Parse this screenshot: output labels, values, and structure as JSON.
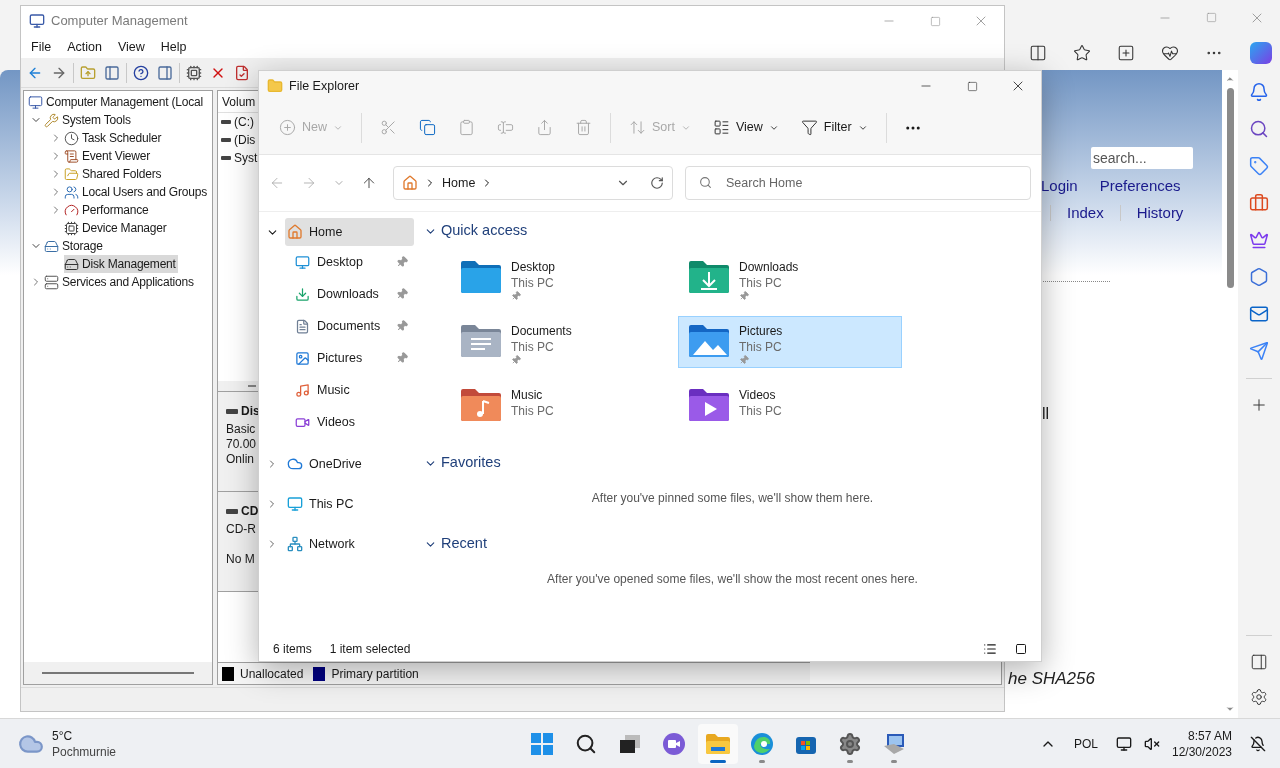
{
  "browser": {
    "search": {
      "placeholder": "search..."
    },
    "links_row_1": [
      "Login",
      "Preferences"
    ],
    "links_row_2": [
      "Index",
      "History"
    ],
    "page_fragment": "ll",
    "page_caption": "he SHA256"
  },
  "computer_management": {
    "title": "Computer Management",
    "menu": [
      "File",
      "Action",
      "View",
      "Help"
    ],
    "tree": [
      {
        "label": "Computer Management (Local",
        "selected": false,
        "children": [
          {
            "label": "System Tools",
            "expanded": true,
            "selected": false,
            "children": [
              {
                "label": "Task Scheduler",
                "expanded": false,
                "selected": false
              },
              {
                "label": "Event Viewer",
                "expanded": false,
                "selected": false
              },
              {
                "label": "Shared Folders",
                "expanded": false,
                "selected": false
              },
              {
                "label": "Local Users and Groups",
                "expanded": false,
                "selected": false
              },
              {
                "label": "Performance",
                "expanded": false,
                "selected": false
              },
              {
                "label": "Device Manager",
                "selected": false
              }
            ]
          },
          {
            "label": "Storage",
            "expanded": true,
            "selected": false,
            "children": [
              {
                "label": "Disk Management",
                "selected": true
              }
            ]
          },
          {
            "label": "Services and Applications",
            "expanded": false,
            "selected": false
          }
        ]
      }
    ],
    "volume_column": "Volum",
    "volumes": [
      "(C:)",
      "(Dis",
      "Syst"
    ],
    "disks": [
      {
        "name": "Dis",
        "lines": [
          "Basic",
          "70.00",
          "Onlin"
        ]
      },
      {
        "name": "CD",
        "lines": [
          "CD-R",
          "No M"
        ]
      }
    ],
    "legend": [
      {
        "label": "Unallocated",
        "color": "#000000"
      },
      {
        "label": "Primary partition",
        "color": "#000080"
      }
    ]
  },
  "file_explorer": {
    "title": "File Explorer",
    "commands": [
      {
        "kind": "new",
        "label": "New",
        "disabled": true
      },
      {
        "kind": "cut",
        "disabled": true
      },
      {
        "kind": "copy",
        "disabled": false
      },
      {
        "kind": "paste",
        "disabled": true
      },
      {
        "kind": "rename",
        "disabled": true
      },
      {
        "kind": "share",
        "disabled": true
      },
      {
        "kind": "delete",
        "disabled": true
      },
      {
        "kind": "sort",
        "label": "Sort",
        "disabled": true
      },
      {
        "kind": "view",
        "label": "View",
        "disabled": false
      },
      {
        "kind": "filter",
        "label": "Filter",
        "disabled": false
      }
    ],
    "address": "Home",
    "search": {
      "placeholder": "Search Home"
    },
    "nav": [
      {
        "kind": "home",
        "label": "Home",
        "expanded": true,
        "selected": true,
        "children": [
          {
            "kind": "desktop",
            "label": "Desktop",
            "pinned": true,
            "selected": false
          },
          {
            "kind": "downloads",
            "label": "Downloads",
            "pinned": true,
            "selected": false
          },
          {
            "kind": "documents",
            "label": "Documents",
            "pinned": true,
            "selected": false
          },
          {
            "kind": "pictures",
            "label": "Pictures",
            "pinned": true,
            "selected": false
          },
          {
            "kind": "music",
            "label": "Music",
            "pinned": false,
            "selected": false
          },
          {
            "kind": "videos",
            "label": "Videos",
            "pinned": false,
            "selected": false
          }
        ]
      },
      {
        "kind": "onedrive",
        "label": "OneDrive",
        "expanded": false,
        "selected": false
      },
      {
        "kind": "thispc",
        "label": "This PC",
        "expanded": false,
        "selected": false
      },
      {
        "kind": "network",
        "label": "Network",
        "expanded": false,
        "selected": false
      }
    ],
    "sections": [
      {
        "title": "Quick access",
        "expanded": true,
        "items": [
          {
            "kind": "desktop",
            "name": "Desktop",
            "location": "This PC",
            "pinned": true,
            "selected": false
          },
          {
            "kind": "downloads",
            "name": "Downloads",
            "location": "This PC",
            "pinned": true,
            "selected": false
          },
          {
            "kind": "documents",
            "name": "Documents",
            "location": "This PC",
            "pinned": true,
            "selected": false
          },
          {
            "kind": "pictures",
            "name": "Pictures",
            "location": "This PC",
            "pinned": true,
            "selected": true
          },
          {
            "kind": "music",
            "name": "Music",
            "location": "This PC",
            "pinned": false,
            "selected": false
          },
          {
            "kind": "videos",
            "name": "Videos",
            "location": "This PC",
            "pinned": false,
            "selected": false
          }
        ]
      },
      {
        "title": "Favorites",
        "expanded": true,
        "message": "After you've pinned some files, we'll show them here."
      },
      {
        "title": "Recent",
        "expanded": true,
        "message": "After you've opened some files, we'll show the most recent ones here."
      }
    ],
    "status": [
      "6 items",
      "1 item selected"
    ]
  },
  "taskbar": {
    "weather": {
      "temperature": "5°C",
      "condition": "Pochmurnie"
    },
    "apps": [
      {
        "kind": "start",
        "running": false,
        "selected": false
      },
      {
        "kind": "search",
        "running": false,
        "selected": false
      },
      {
        "kind": "taskview",
        "running": false,
        "selected": false
      },
      {
        "kind": "meet",
        "running": false,
        "selected": false
      },
      {
        "kind": "explorer",
        "running": true,
        "selected": true
      },
      {
        "kind": "edge",
        "running": true,
        "selected": false
      },
      {
        "kind": "store",
        "running": false,
        "selected": false
      },
      {
        "kind": "settings",
        "running": true,
        "selected": false
      },
      {
        "kind": "compmgmt",
        "running": true,
        "selected": false
      }
    ],
    "language": "POL",
    "time": "8:57 AM",
    "date": "12/30/2023"
  }
}
